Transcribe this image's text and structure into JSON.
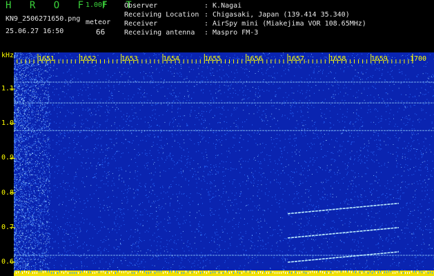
{
  "header": {
    "app_title": "H R O F F T",
    "version": "1.00f",
    "file_name": "KN9_2506271650.png",
    "mode_label": "meteor",
    "timestamp": "25.06.27 16:50",
    "count": "66"
  },
  "station_info": [
    {
      "key": "Observer",
      "value": ": K.Nagai"
    },
    {
      "key": "Receiving Location",
      "value": ": Chigasaki, Japan (139.414 35.340)"
    },
    {
      "key": "Receiver",
      "value": ": AirSpy mini (Miakejima VOR 108.65MHz)"
    },
    {
      "key": "Receiving antenna",
      "value": ": Maspro FM-3"
    }
  ],
  "chart_data": {
    "type": "heatmap",
    "y_unit": "kHz",
    "y_ticks": [
      "1.1",
      "1.0",
      "0.9",
      "0.8",
      "0.7",
      "0.6"
    ],
    "x_ticks": [
      "1651",
      "1652",
      "1653",
      "1654",
      "1655",
      "1656",
      "1657",
      "1658",
      "1659",
      "1700"
    ],
    "colors": {
      "background": "#0a24b0",
      "noise": "#2a6cff",
      "carrier": "#9fdcff",
      "tick": "#ffff00",
      "footer": "#f0e000"
    },
    "horizontal_carriers_khz": [
      1.12,
      1.06,
      0.98,
      0.62
    ],
    "meteor_echoes": [
      {
        "start": [
          "16:57",
          0.74
        ],
        "end": [
          "16:59:40",
          0.77
        ]
      },
      {
        "start": [
          "16:57",
          0.67
        ],
        "end": [
          "16:59:40",
          0.7
        ]
      },
      {
        "start": [
          "16:57",
          0.6
        ],
        "end": [
          "16:59:40",
          0.63
        ]
      }
    ]
  }
}
